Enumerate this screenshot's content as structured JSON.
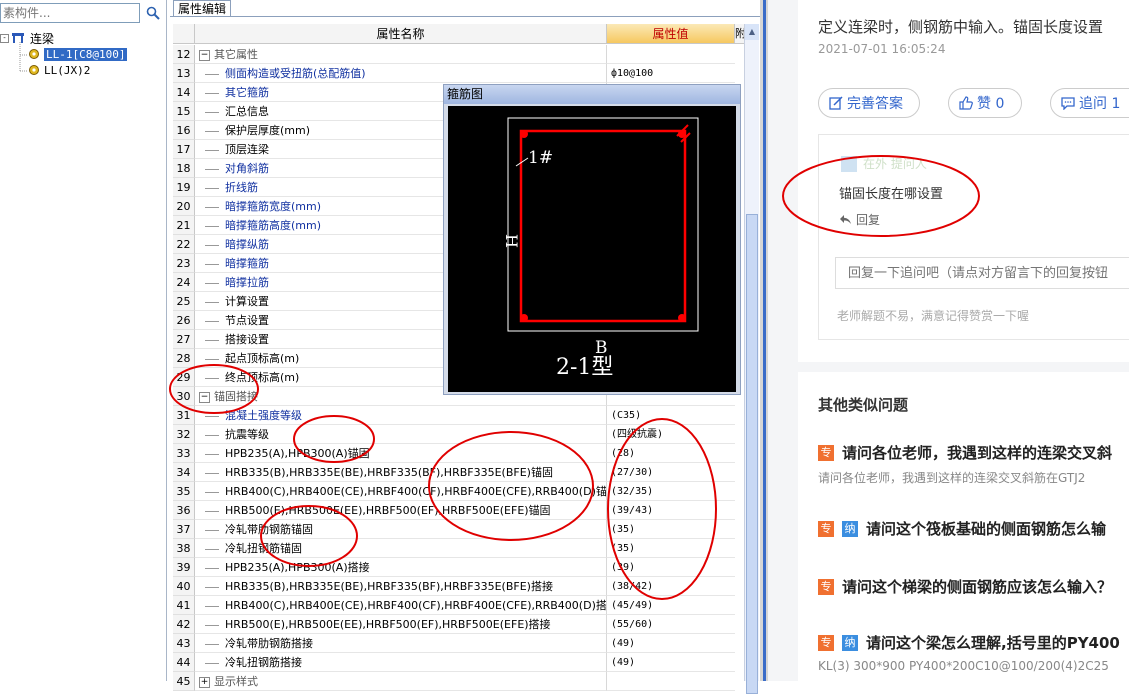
{
  "left_panel": {
    "search_placeholder": "素构件...",
    "tree_root": "连梁",
    "tree_items": [
      "LL-1[C8@100]",
      "LL(JX)2"
    ]
  },
  "prop_editor": {
    "tab": "属性编辑",
    "col_name": "属性名称",
    "col_value": "属性值",
    "col_extra": "附",
    "rows": [
      {
        "n": "12",
        "name": "其它属性",
        "group": true,
        "val": ""
      },
      {
        "n": "13",
        "name": "侧面构造或受扭筋(总配筋值)",
        "blue": true,
        "val": "ф10@100"
      },
      {
        "n": "14",
        "name": "其它箍筋",
        "blue": true,
        "val": ""
      },
      {
        "n": "15",
        "name": "汇总信息",
        "val": ""
      },
      {
        "n": "16",
        "name": "保护层厚度(mm)",
        "val": ""
      },
      {
        "n": "17",
        "name": "顶层连梁",
        "val": ""
      },
      {
        "n": "18",
        "name": "对角斜筋",
        "blue": true,
        "val": ""
      },
      {
        "n": "19",
        "name": "折线筋",
        "blue": true,
        "val": ""
      },
      {
        "n": "20",
        "name": "暗撑箍筋宽度(mm)",
        "blue": true,
        "val": ""
      },
      {
        "n": "21",
        "name": "暗撑箍筋高度(mm)",
        "blue": true,
        "val": ""
      },
      {
        "n": "22",
        "name": "暗撑纵筋",
        "blue": true,
        "val": ""
      },
      {
        "n": "23",
        "name": "暗撑箍筋",
        "blue": true,
        "val": ""
      },
      {
        "n": "24",
        "name": "暗撑拉筋",
        "blue": true,
        "val": ""
      },
      {
        "n": "25",
        "name": "计算设置",
        "val": ""
      },
      {
        "n": "26",
        "name": "节点设置",
        "val": ""
      },
      {
        "n": "27",
        "name": "搭接设置",
        "val": ""
      },
      {
        "n": "28",
        "name": "起点顶标高(m)",
        "val": ""
      },
      {
        "n": "29",
        "name": "终点顶标高(m)",
        "val": ""
      },
      {
        "n": "30",
        "name": "锚固搭接",
        "group": true,
        "val": ""
      },
      {
        "n": "31",
        "name": "混凝土强度等级",
        "blue": true,
        "val": "(C35)"
      },
      {
        "n": "32",
        "name": "抗震等级",
        "val": "(四级抗震)"
      },
      {
        "n": "33",
        "name": "HPB235(A),HPB300(A)锚固",
        "val": "(28)"
      },
      {
        "n": "34",
        "name": "HRB335(B),HRB335E(BE),HRBF335(BF),HRBF335E(BFE)锚固",
        "val": "(27/30)"
      },
      {
        "n": "35",
        "name": "HRB400(C),HRB400E(CE),HRBF400(CF),HRBF400E(CFE),RRB400(D)锚固",
        "val": "(32/35)"
      },
      {
        "n": "36",
        "name": "HRB500(E),HRB500E(EE),HRBF500(EF),HRBF500E(EFE)锚固",
        "val": "(39/43)"
      },
      {
        "n": "37",
        "name": "冷轧带肋钢筋锚固",
        "val": "(35)"
      },
      {
        "n": "38",
        "name": "冷轧扭钢筋锚固",
        "val": "(35)"
      },
      {
        "n": "39",
        "name": "HPB235(A),HPB300(A)搭接",
        "val": "(39)"
      },
      {
        "n": "40",
        "name": "HRB335(B),HRB335E(BE),HRBF335(BF),HRBF335E(BFE)搭接",
        "val": "(38/42)"
      },
      {
        "n": "41",
        "name": "HRB400(C),HRB400E(CE),HRBF400(CF),HRBF400E(CFE),RRB400(D)搭接",
        "val": "(45/49)"
      },
      {
        "n": "42",
        "name": "HRB500(E),HRB500E(EE),HRBF500(EF),HRBF500E(EFE)搭接",
        "val": "(55/60)"
      },
      {
        "n": "43",
        "name": "冷轧带肋钢筋搭接",
        "val": "(49)"
      },
      {
        "n": "44",
        "name": "冷轧扭钢筋搭接",
        "val": "(49)"
      },
      {
        "n": "45",
        "name": "显示样式",
        "group": true,
        "val": ""
      }
    ]
  },
  "popup": {
    "title": "箍筋图",
    "label_1": "1#",
    "label_h": "H",
    "label_b": "B",
    "label_type": "2-1型"
  },
  "qa": {
    "question": "定义连梁时，侧钢筋中输入。锚固长度设置",
    "date": "2021-07-01 16:05:24",
    "btn_complete": "完善答案",
    "btn_like": "赞 0",
    "btn_follow": "追问 1",
    "fu_user": "在外 提问人",
    "fu_question": "锚固长度在哪设置",
    "fu_reply": "回复",
    "fu_input_placeholder": "回复一下追问吧（请点对方留言下的回复按钮",
    "fu_hint": "老师解题不易，满意记得赞赏一下喔",
    "similar_title": "其他类似问题",
    "similar": [
      {
        "badges": [
          "专"
        ],
        "title": "请问各位老师，我遇到这样的连梁交叉斜",
        "sub": "请问各位老师，我遇到这样的连梁交叉斜筋在GTJ2"
      },
      {
        "badges": [
          "专",
          "纳"
        ],
        "title": "请问这个筏板基础的侧面钢筋怎么输",
        "sub": ""
      },
      {
        "badges": [
          "专"
        ],
        "title": "请问这个梯梁的侧面钢筋应该怎么输入？",
        "sub": ""
      },
      {
        "badges": [
          "专",
          "纳"
        ],
        "title": "请问这个梁怎么理解,括号里的PY400",
        "sub": "KL(3) 300*900 PY400*200C10@100/200(4)2C25"
      }
    ]
  },
  "colors": {
    "annotation": "#e00000",
    "selection": "#316ac5",
    "blue_label": "#1030a0",
    "header_value": "#f6c860"
  }
}
